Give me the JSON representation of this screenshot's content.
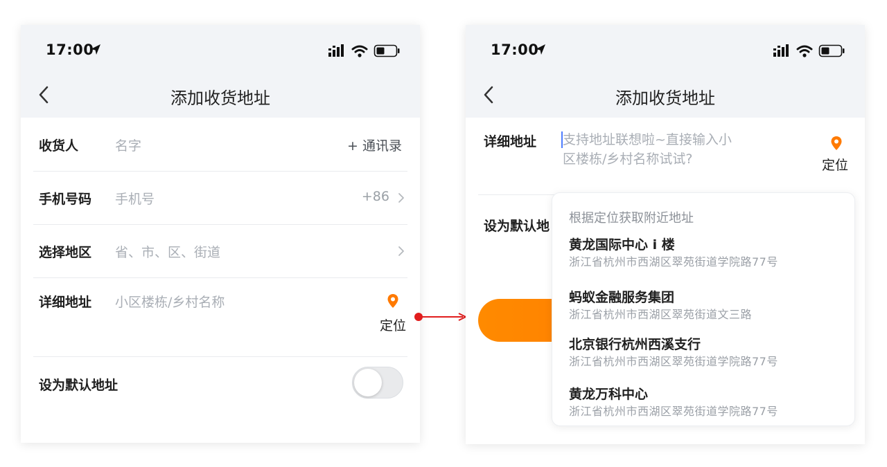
{
  "left_screen": {
    "status_time": "17:00",
    "nav_title": "添加收货地址",
    "rows": {
      "receiver": {
        "label": "收货人",
        "placeholder": "名字",
        "action": "+ 通讯录"
      },
      "phone": {
        "label": "手机号码",
        "placeholder": "手机号",
        "country_code": "+86"
      },
      "region": {
        "label": "选择地区",
        "placeholder": "省、市、区、街道"
      },
      "detail": {
        "label": "详细地址",
        "placeholder": "小区楼栋/乡村名称",
        "locate": "定位"
      },
      "default": {
        "label": "设为默认地址",
        "toggle_on": false
      }
    }
  },
  "right_screen": {
    "status_time": "17:00",
    "nav_title": "添加收货地址",
    "detail": {
      "label": "详细地址",
      "placeholder_line1": "支持地址联想啦~直接输入小",
      "placeholder_line2": "区楼栋/乡村名称试试?",
      "locate": "定位"
    },
    "default_label_partial": "设为默认地",
    "suggestions": {
      "header": "根据定位获取附近地址",
      "items": [
        {
          "name": "黄龙国际中心 i 楼",
          "address": "浙江省杭州市西湖区翠苑街道学院路77号"
        },
        {
          "name": "蚂蚁金融服务集团",
          "address": "浙江省杭州市西湖区翠苑街道文三路"
        },
        {
          "name": "北京银行杭州西溪支行",
          "address": "浙江省杭州市西湖区翠苑街道学院路77号"
        },
        {
          "name": "黄龙万科中心",
          "address": "浙江省杭州市西湖区翠苑街道学院路77号"
        }
      ]
    }
  },
  "colors": {
    "accent_orange": "#ff8a00",
    "arrow_red": "#e11d1d",
    "caret_blue": "#4d7cff",
    "header_bg": "#f2f4f7"
  },
  "icons": [
    "location-arrow-icon",
    "signal-icon",
    "wifi-icon",
    "battery-icon",
    "back-chevron-icon",
    "chevron-right-icon",
    "location-pin-icon"
  ]
}
